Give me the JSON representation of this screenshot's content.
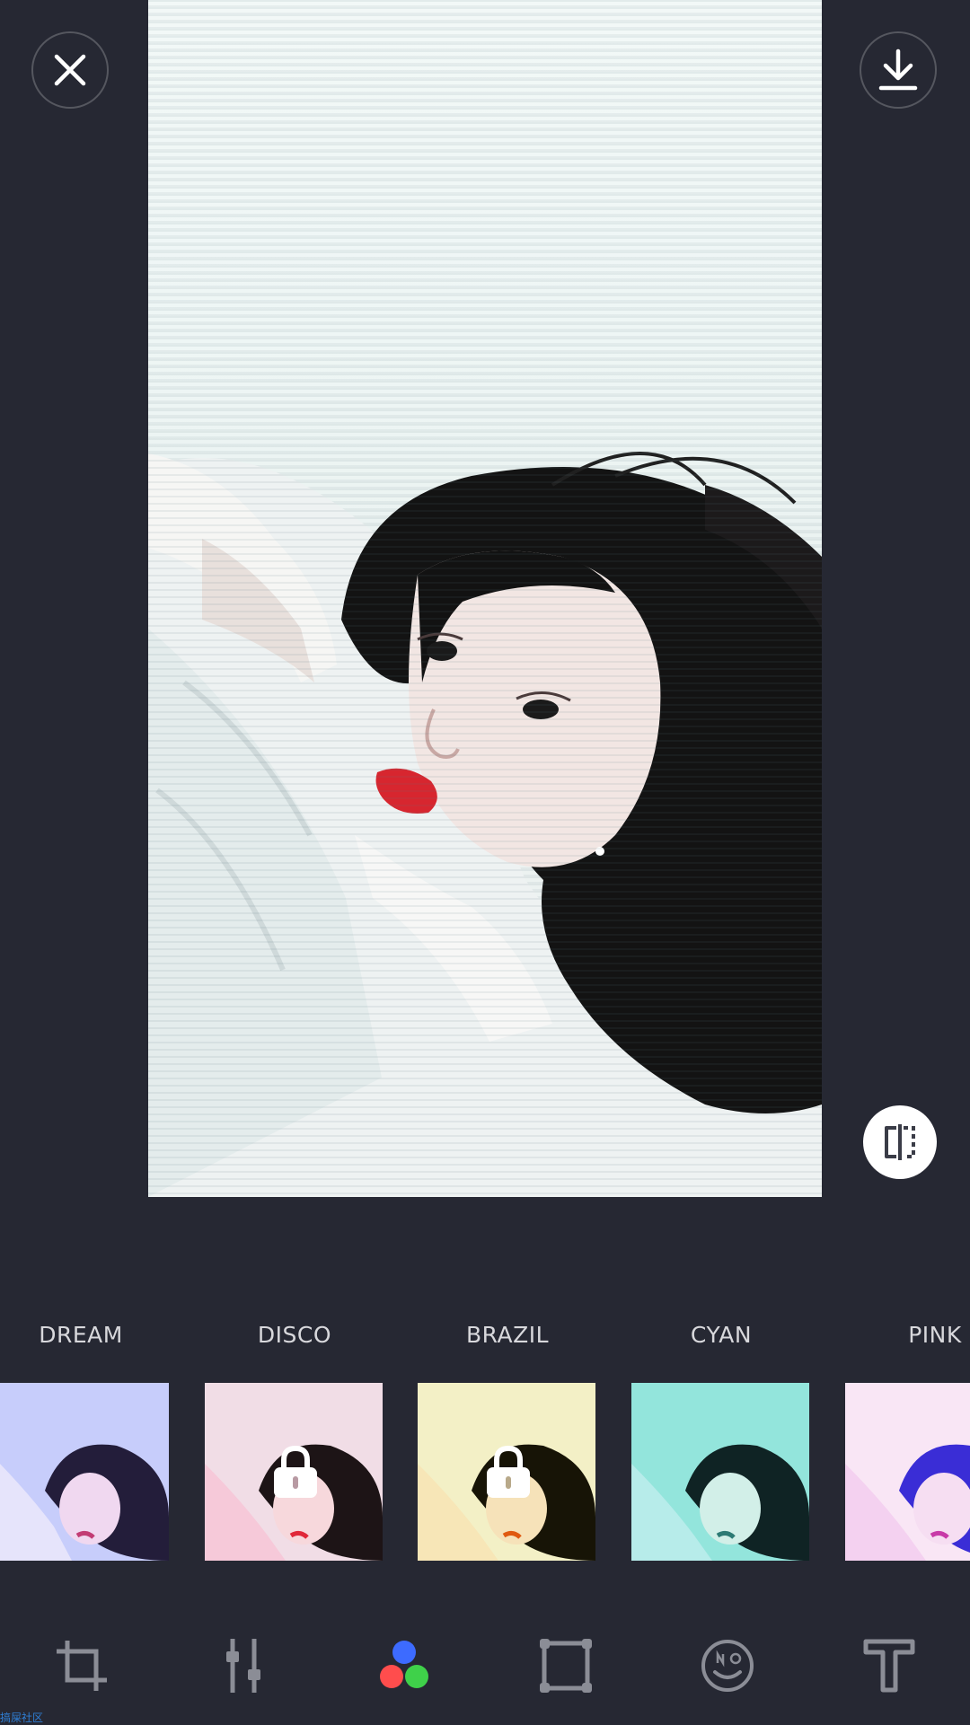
{
  "header": {
    "close_icon": "close-icon",
    "download_icon": "download-icon"
  },
  "preview": {
    "compare_icon": "compare-split-icon"
  },
  "filters": [
    {
      "label": "DREAM",
      "locked": false,
      "tint": "#b9c3ff"
    },
    {
      "label": "DISCO",
      "locked": true,
      "tint": "#f2c2d6"
    },
    {
      "label": "BRAZIL",
      "locked": true,
      "tint": "#f3e7a8"
    },
    {
      "label": "CYAN",
      "locked": false,
      "tint": "#8de6dc"
    },
    {
      "label": "PINK",
      "locked": false,
      "tint": "#f7d9f2"
    }
  ],
  "toolbar": {
    "tools": [
      "crop-icon",
      "adjust-sliders-icon",
      "filter-icon",
      "frame-icon",
      "sticker-icon",
      "text-icon"
    ],
    "active": "filter-icon"
  },
  "watermark": "搞屎社区",
  "colors": {
    "background": "#262833",
    "filter_red": "#ff4d4d",
    "filter_green": "#3fd14a",
    "filter_blue": "#3d6bff"
  }
}
